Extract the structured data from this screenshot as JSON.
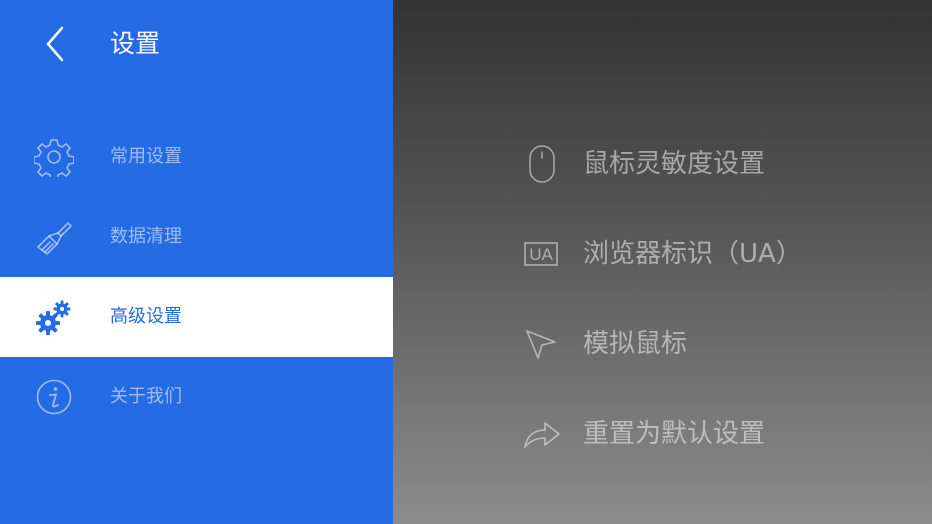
{
  "header": {
    "title": "设置"
  },
  "sidebar": {
    "items": [
      {
        "label": "常用设置",
        "icon": "gear-icon",
        "active": false
      },
      {
        "label": "数据清理",
        "icon": "broom-icon",
        "active": false
      },
      {
        "label": "高级设置",
        "icon": "gears-icon",
        "active": true
      },
      {
        "label": "关于我们",
        "icon": "info-icon",
        "active": false
      }
    ]
  },
  "main": {
    "options": [
      {
        "label": "鼠标灵敏度设置",
        "icon": "mouse-icon"
      },
      {
        "label": "浏览器标识（UA）",
        "icon": "ua-icon",
        "icon_text": "UA"
      },
      {
        "label": "模拟鼠标",
        "icon": "cursor-arrow-icon"
      },
      {
        "label": "重置为默认设置",
        "icon": "share-arrow-icon"
      }
    ]
  },
  "colors": {
    "accent": "#246be4",
    "active_bg": "#ffffff"
  }
}
